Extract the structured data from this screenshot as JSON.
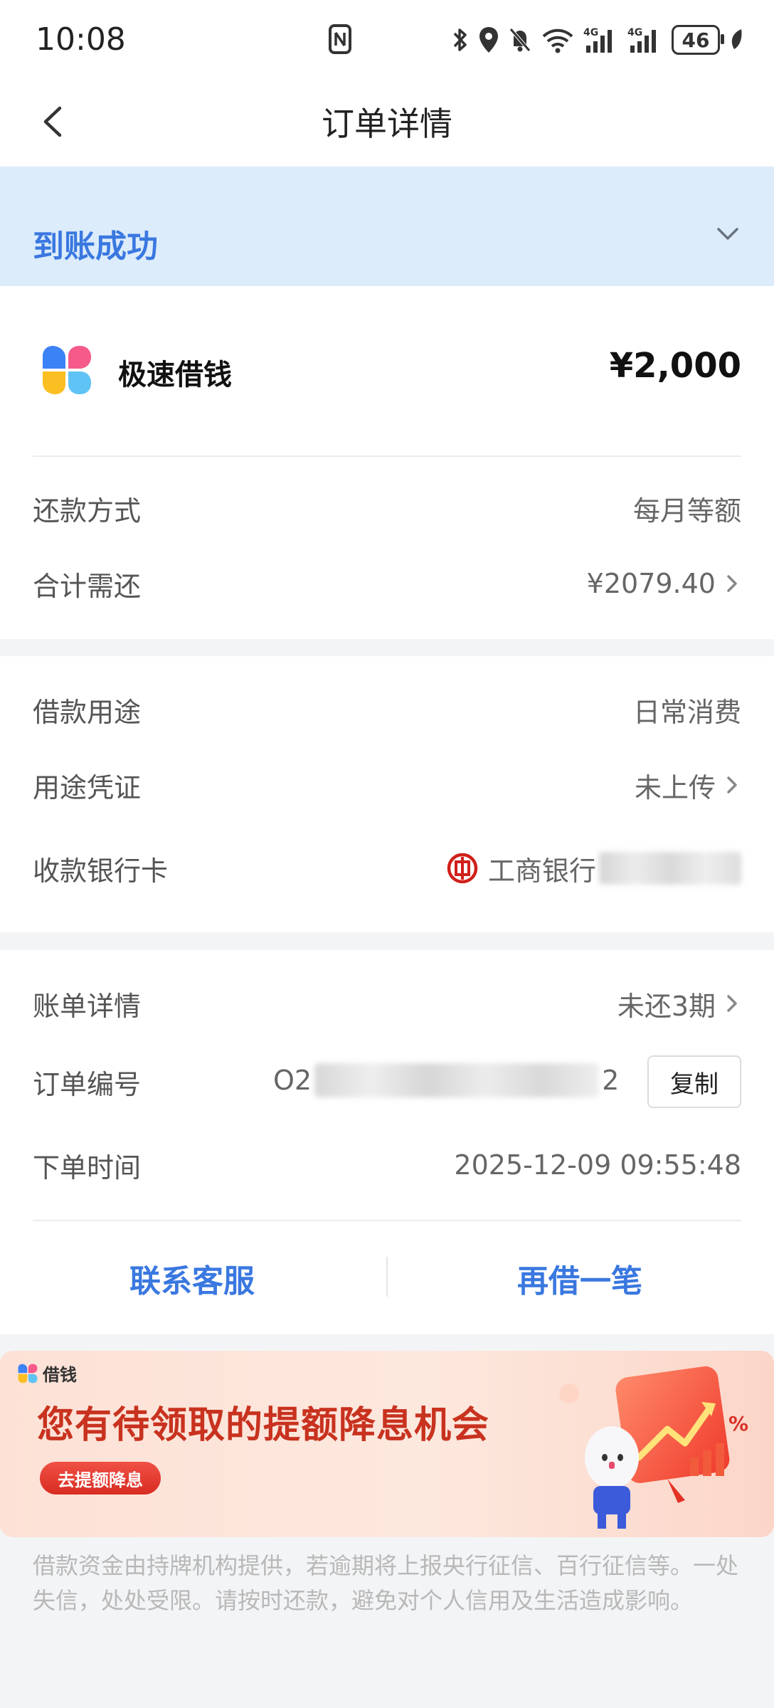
{
  "status_bar": {
    "time": "10:08",
    "battery": "46"
  },
  "nav": {
    "title": "订单详情",
    "back_icon": "chevron-left-icon"
  },
  "banner": {
    "status": "到账成功",
    "expand_icon": "chevron-down-icon"
  },
  "product": {
    "name": "极速借钱",
    "amount": "¥2,000",
    "logo_icon": "four-petal-logo-icon"
  },
  "repayment": {
    "method_label": "还款方式",
    "method_value": "每月等额",
    "total_label": "合计需还",
    "total_value": "¥2079.40"
  },
  "loan": {
    "purpose_label": "借款用途",
    "purpose_value": "日常消费",
    "proof_label": "用途凭证",
    "proof_value": "未上传",
    "bank_label": "收款银行卡",
    "bank_value": "工商银行"
  },
  "order": {
    "bill_label": "账单详情",
    "bill_value": "未还3期",
    "number_label": "订单编号",
    "number_prefix": "O2",
    "number_suffix": "2",
    "copy_label": "复制",
    "time_label": "下单时间",
    "time_value": "2025-12-09 09:55:48"
  },
  "actions": {
    "contact": "联系客服",
    "borrow_again": "再借一笔"
  },
  "promo": {
    "tag": "借钱",
    "title": "您有待领取的提额降息机会",
    "button": "去提额降息",
    "percent": "%"
  },
  "disclaimer": "借款资金由持牌机构提供，若逾期将上报央行征信、百行征信等。一处失信，处处受限。请按时还款，避免对个人信用及生活造成影响。",
  "colors": {
    "accent": "#3a78e0",
    "banner_bg": "#dcecfb",
    "promo_red": "#c8321f",
    "bank_red": "#d0201b"
  }
}
